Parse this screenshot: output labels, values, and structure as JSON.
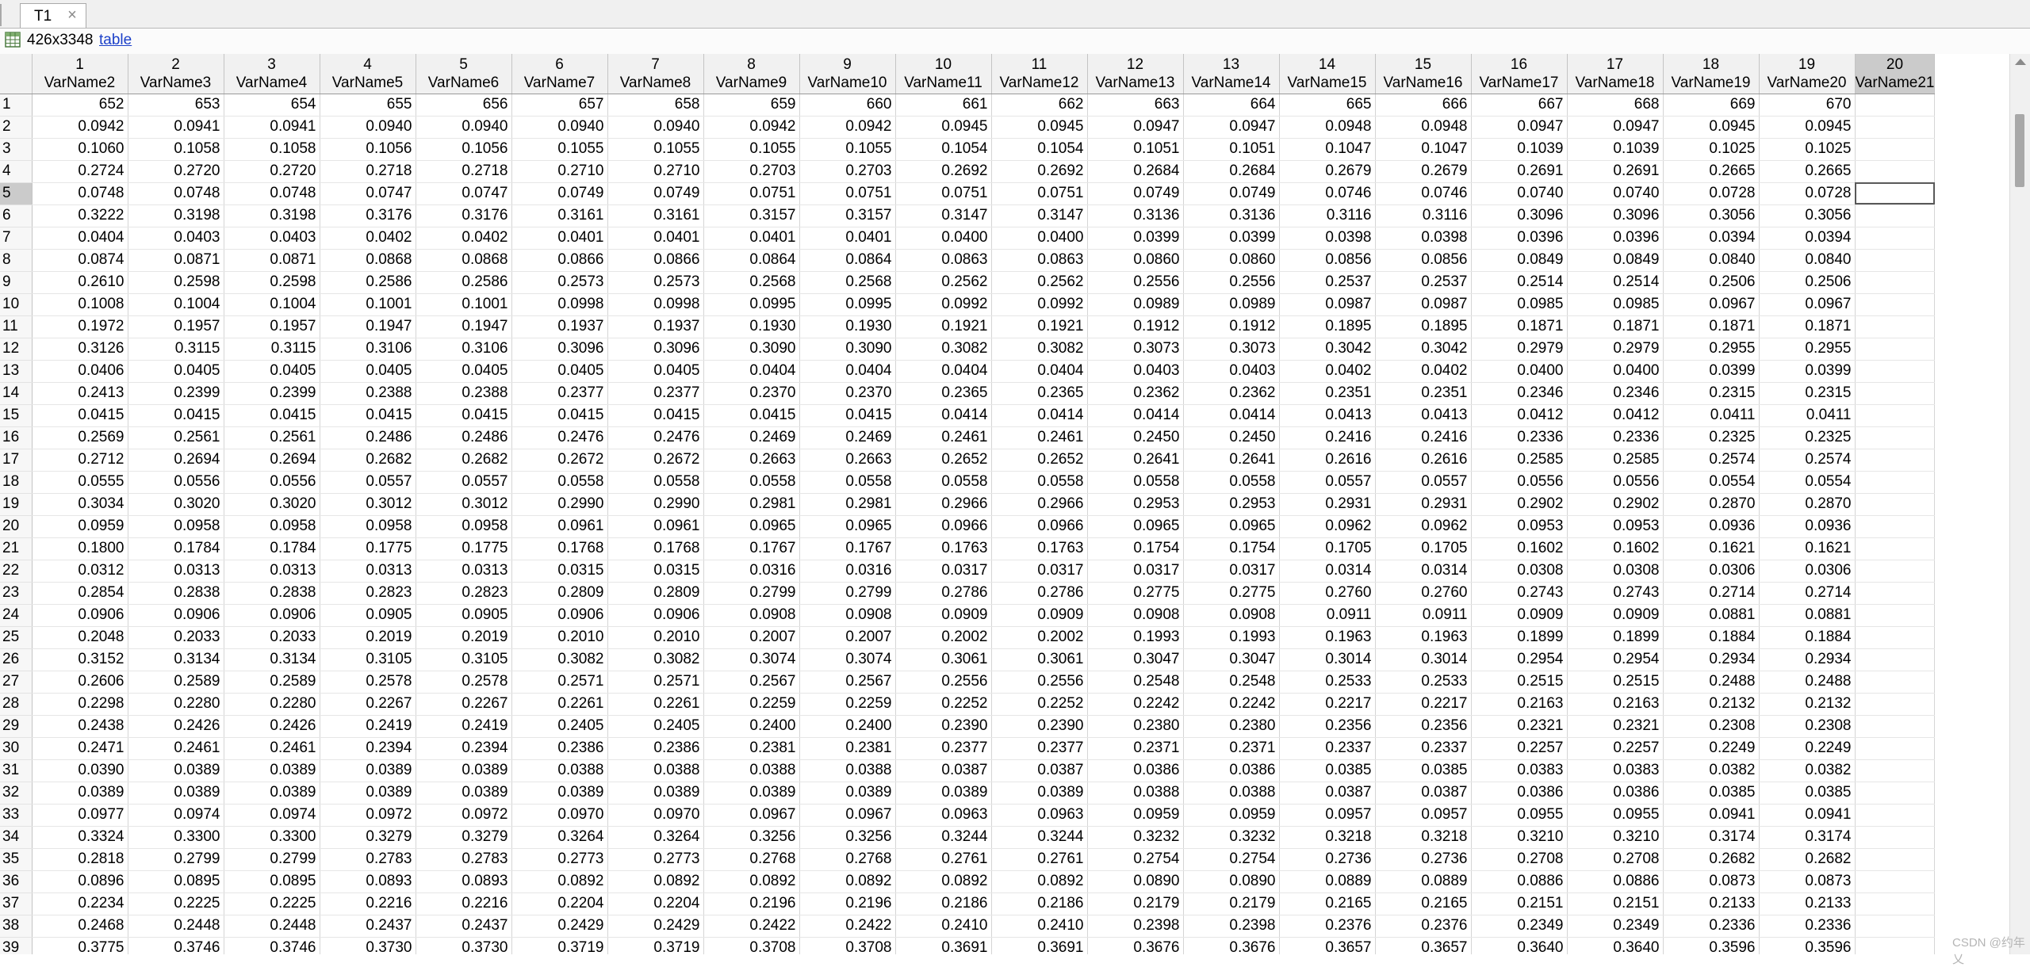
{
  "tab": {
    "title": "T1",
    "close_glyph": "×"
  },
  "info": {
    "size": "426x3348",
    "type_link": "table",
    "icon": "table-icon"
  },
  "columns": [
    {
      "index": "1",
      "name": "VarName2"
    },
    {
      "index": "2",
      "name": "VarName3"
    },
    {
      "index": "3",
      "name": "VarName4"
    },
    {
      "index": "4",
      "name": "VarName5"
    },
    {
      "index": "5",
      "name": "VarName6"
    },
    {
      "index": "6",
      "name": "VarName7"
    },
    {
      "index": "7",
      "name": "VarName8"
    },
    {
      "index": "8",
      "name": "VarName9"
    },
    {
      "index": "9",
      "name": "VarName10"
    },
    {
      "index": "10",
      "name": "VarName11"
    },
    {
      "index": "11",
      "name": "VarName12"
    },
    {
      "index": "12",
      "name": "VarName13"
    },
    {
      "index": "13",
      "name": "VarName14"
    },
    {
      "index": "14",
      "name": "VarName15"
    },
    {
      "index": "15",
      "name": "VarName16"
    },
    {
      "index": "16",
      "name": "VarName17"
    },
    {
      "index": "17",
      "name": "VarName18"
    },
    {
      "index": "18",
      "name": "VarName19"
    },
    {
      "index": "19",
      "name": "VarName20"
    },
    {
      "index": "20",
      "name": "VarName21"
    }
  ],
  "selected_row": 5,
  "selected_col": 20,
  "rows": [
    [
      "652",
      "653",
      "654",
      "655",
      "656",
      "657",
      "658",
      "659",
      "660",
      "661",
      "662",
      "663",
      "664",
      "665",
      "666",
      "667",
      "668",
      "669",
      "670",
      ""
    ],
    [
      "0.0942",
      "0.0941",
      "0.0941",
      "0.0940",
      "0.0940",
      "0.0940",
      "0.0940",
      "0.0942",
      "0.0942",
      "0.0945",
      "0.0945",
      "0.0947",
      "0.0947",
      "0.0948",
      "0.0948",
      "0.0947",
      "0.0947",
      "0.0945",
      "0.0945",
      ""
    ],
    [
      "0.1060",
      "0.1058",
      "0.1058",
      "0.1056",
      "0.1056",
      "0.1055",
      "0.1055",
      "0.1055",
      "0.1055",
      "0.1054",
      "0.1054",
      "0.1051",
      "0.1051",
      "0.1047",
      "0.1047",
      "0.1039",
      "0.1039",
      "0.1025",
      "0.1025",
      ""
    ],
    [
      "0.2724",
      "0.2720",
      "0.2720",
      "0.2718",
      "0.2718",
      "0.2710",
      "0.2710",
      "0.2703",
      "0.2703",
      "0.2692",
      "0.2692",
      "0.2684",
      "0.2684",
      "0.2679",
      "0.2679",
      "0.2691",
      "0.2691",
      "0.2665",
      "0.2665",
      ""
    ],
    [
      "0.0748",
      "0.0748",
      "0.0748",
      "0.0747",
      "0.0747",
      "0.0749",
      "0.0749",
      "0.0751",
      "0.0751",
      "0.0751",
      "0.0751",
      "0.0749",
      "0.0749",
      "0.0746",
      "0.0746",
      "0.0740",
      "0.0740",
      "0.0728",
      "0.0728",
      ""
    ],
    [
      "0.3222",
      "0.3198",
      "0.3198",
      "0.3176",
      "0.3176",
      "0.3161",
      "0.3161",
      "0.3157",
      "0.3157",
      "0.3147",
      "0.3147",
      "0.3136",
      "0.3136",
      "0.3116",
      "0.3116",
      "0.3096",
      "0.3096",
      "0.3056",
      "0.3056",
      ""
    ],
    [
      "0.0404",
      "0.0403",
      "0.0403",
      "0.0402",
      "0.0402",
      "0.0401",
      "0.0401",
      "0.0401",
      "0.0401",
      "0.0400",
      "0.0400",
      "0.0399",
      "0.0399",
      "0.0398",
      "0.0398",
      "0.0396",
      "0.0396",
      "0.0394",
      "0.0394",
      ""
    ],
    [
      "0.0874",
      "0.0871",
      "0.0871",
      "0.0868",
      "0.0868",
      "0.0866",
      "0.0866",
      "0.0864",
      "0.0864",
      "0.0863",
      "0.0863",
      "0.0860",
      "0.0860",
      "0.0856",
      "0.0856",
      "0.0849",
      "0.0849",
      "0.0840",
      "0.0840",
      ""
    ],
    [
      "0.2610",
      "0.2598",
      "0.2598",
      "0.2586",
      "0.2586",
      "0.2573",
      "0.2573",
      "0.2568",
      "0.2568",
      "0.2562",
      "0.2562",
      "0.2556",
      "0.2556",
      "0.2537",
      "0.2537",
      "0.2514",
      "0.2514",
      "0.2506",
      "0.2506",
      ""
    ],
    [
      "0.1008",
      "0.1004",
      "0.1004",
      "0.1001",
      "0.1001",
      "0.0998",
      "0.0998",
      "0.0995",
      "0.0995",
      "0.0992",
      "0.0992",
      "0.0989",
      "0.0989",
      "0.0987",
      "0.0987",
      "0.0985",
      "0.0985",
      "0.0967",
      "0.0967",
      ""
    ],
    [
      "0.1972",
      "0.1957",
      "0.1957",
      "0.1947",
      "0.1947",
      "0.1937",
      "0.1937",
      "0.1930",
      "0.1930",
      "0.1921",
      "0.1921",
      "0.1912",
      "0.1912",
      "0.1895",
      "0.1895",
      "0.1871",
      "0.1871",
      "0.1871",
      "0.1871",
      ""
    ],
    [
      "0.3126",
      "0.3115",
      "0.3115",
      "0.3106",
      "0.3106",
      "0.3096",
      "0.3096",
      "0.3090",
      "0.3090",
      "0.3082",
      "0.3082",
      "0.3073",
      "0.3073",
      "0.3042",
      "0.3042",
      "0.2979",
      "0.2979",
      "0.2955",
      "0.2955",
      ""
    ],
    [
      "0.0406",
      "0.0405",
      "0.0405",
      "0.0405",
      "0.0405",
      "0.0405",
      "0.0405",
      "0.0404",
      "0.0404",
      "0.0404",
      "0.0404",
      "0.0403",
      "0.0403",
      "0.0402",
      "0.0402",
      "0.0400",
      "0.0400",
      "0.0399",
      "0.0399",
      ""
    ],
    [
      "0.2413",
      "0.2399",
      "0.2399",
      "0.2388",
      "0.2388",
      "0.2377",
      "0.2377",
      "0.2370",
      "0.2370",
      "0.2365",
      "0.2365",
      "0.2362",
      "0.2362",
      "0.2351",
      "0.2351",
      "0.2346",
      "0.2346",
      "0.2315",
      "0.2315",
      ""
    ],
    [
      "0.0415",
      "0.0415",
      "0.0415",
      "0.0415",
      "0.0415",
      "0.0415",
      "0.0415",
      "0.0415",
      "0.0415",
      "0.0414",
      "0.0414",
      "0.0414",
      "0.0414",
      "0.0413",
      "0.0413",
      "0.0412",
      "0.0412",
      "0.0411",
      "0.0411",
      ""
    ],
    [
      "0.2569",
      "0.2561",
      "0.2561",
      "0.2486",
      "0.2486",
      "0.2476",
      "0.2476",
      "0.2469",
      "0.2469",
      "0.2461",
      "0.2461",
      "0.2450",
      "0.2450",
      "0.2416",
      "0.2416",
      "0.2336",
      "0.2336",
      "0.2325",
      "0.2325",
      ""
    ],
    [
      "0.2712",
      "0.2694",
      "0.2694",
      "0.2682",
      "0.2682",
      "0.2672",
      "0.2672",
      "0.2663",
      "0.2663",
      "0.2652",
      "0.2652",
      "0.2641",
      "0.2641",
      "0.2616",
      "0.2616",
      "0.2585",
      "0.2585",
      "0.2574",
      "0.2574",
      ""
    ],
    [
      "0.0555",
      "0.0556",
      "0.0556",
      "0.0557",
      "0.0557",
      "0.0558",
      "0.0558",
      "0.0558",
      "0.0558",
      "0.0558",
      "0.0558",
      "0.0558",
      "0.0558",
      "0.0557",
      "0.0557",
      "0.0556",
      "0.0556",
      "0.0554",
      "0.0554",
      ""
    ],
    [
      "0.3034",
      "0.3020",
      "0.3020",
      "0.3012",
      "0.3012",
      "0.2990",
      "0.2990",
      "0.2981",
      "0.2981",
      "0.2966",
      "0.2966",
      "0.2953",
      "0.2953",
      "0.2931",
      "0.2931",
      "0.2902",
      "0.2902",
      "0.2870",
      "0.2870",
      ""
    ],
    [
      "0.0959",
      "0.0958",
      "0.0958",
      "0.0958",
      "0.0958",
      "0.0961",
      "0.0961",
      "0.0965",
      "0.0965",
      "0.0966",
      "0.0966",
      "0.0965",
      "0.0965",
      "0.0962",
      "0.0962",
      "0.0953",
      "0.0953",
      "0.0936",
      "0.0936",
      ""
    ],
    [
      "0.1800",
      "0.1784",
      "0.1784",
      "0.1775",
      "0.1775",
      "0.1768",
      "0.1768",
      "0.1767",
      "0.1767",
      "0.1763",
      "0.1763",
      "0.1754",
      "0.1754",
      "0.1705",
      "0.1705",
      "0.1602",
      "0.1602",
      "0.1621",
      "0.1621",
      ""
    ],
    [
      "0.0312",
      "0.0313",
      "0.0313",
      "0.0313",
      "0.0313",
      "0.0315",
      "0.0315",
      "0.0316",
      "0.0316",
      "0.0317",
      "0.0317",
      "0.0317",
      "0.0317",
      "0.0314",
      "0.0314",
      "0.0308",
      "0.0308",
      "0.0306",
      "0.0306",
      ""
    ],
    [
      "0.2854",
      "0.2838",
      "0.2838",
      "0.2823",
      "0.2823",
      "0.2809",
      "0.2809",
      "0.2799",
      "0.2799",
      "0.2786",
      "0.2786",
      "0.2775",
      "0.2775",
      "0.2760",
      "0.2760",
      "0.2743",
      "0.2743",
      "0.2714",
      "0.2714",
      ""
    ],
    [
      "0.0906",
      "0.0906",
      "0.0906",
      "0.0905",
      "0.0905",
      "0.0906",
      "0.0906",
      "0.0908",
      "0.0908",
      "0.0909",
      "0.0909",
      "0.0908",
      "0.0908",
      "0.0911",
      "0.0911",
      "0.0909",
      "0.0909",
      "0.0881",
      "0.0881",
      ""
    ],
    [
      "0.2048",
      "0.2033",
      "0.2033",
      "0.2019",
      "0.2019",
      "0.2010",
      "0.2010",
      "0.2007",
      "0.2007",
      "0.2002",
      "0.2002",
      "0.1993",
      "0.1993",
      "0.1963",
      "0.1963",
      "0.1899",
      "0.1899",
      "0.1884",
      "0.1884",
      ""
    ],
    [
      "0.3152",
      "0.3134",
      "0.3134",
      "0.3105",
      "0.3105",
      "0.3082",
      "0.3082",
      "0.3074",
      "0.3074",
      "0.3061",
      "0.3061",
      "0.3047",
      "0.3047",
      "0.3014",
      "0.3014",
      "0.2954",
      "0.2954",
      "0.2934",
      "0.2934",
      ""
    ],
    [
      "0.2606",
      "0.2589",
      "0.2589",
      "0.2578",
      "0.2578",
      "0.2571",
      "0.2571",
      "0.2567",
      "0.2567",
      "0.2556",
      "0.2556",
      "0.2548",
      "0.2548",
      "0.2533",
      "0.2533",
      "0.2515",
      "0.2515",
      "0.2488",
      "0.2488",
      ""
    ],
    [
      "0.2298",
      "0.2280",
      "0.2280",
      "0.2267",
      "0.2267",
      "0.2261",
      "0.2261",
      "0.2259",
      "0.2259",
      "0.2252",
      "0.2252",
      "0.2242",
      "0.2242",
      "0.2217",
      "0.2217",
      "0.2163",
      "0.2163",
      "0.2132",
      "0.2132",
      ""
    ],
    [
      "0.2438",
      "0.2426",
      "0.2426",
      "0.2419",
      "0.2419",
      "0.2405",
      "0.2405",
      "0.2400",
      "0.2400",
      "0.2390",
      "0.2390",
      "0.2380",
      "0.2380",
      "0.2356",
      "0.2356",
      "0.2321",
      "0.2321",
      "0.2308",
      "0.2308",
      ""
    ],
    [
      "0.2471",
      "0.2461",
      "0.2461",
      "0.2394",
      "0.2394",
      "0.2386",
      "0.2386",
      "0.2381",
      "0.2381",
      "0.2377",
      "0.2377",
      "0.2371",
      "0.2371",
      "0.2337",
      "0.2337",
      "0.2257",
      "0.2257",
      "0.2249",
      "0.2249",
      ""
    ],
    [
      "0.0390",
      "0.0389",
      "0.0389",
      "0.0389",
      "0.0389",
      "0.0388",
      "0.0388",
      "0.0388",
      "0.0388",
      "0.0387",
      "0.0387",
      "0.0386",
      "0.0386",
      "0.0385",
      "0.0385",
      "0.0383",
      "0.0383",
      "0.0382",
      "0.0382",
      ""
    ],
    [
      "0.0389",
      "0.0389",
      "0.0389",
      "0.0389",
      "0.0389",
      "0.0389",
      "0.0389",
      "0.0389",
      "0.0389",
      "0.0389",
      "0.0389",
      "0.0388",
      "0.0388",
      "0.0387",
      "0.0387",
      "0.0386",
      "0.0386",
      "0.0385",
      "0.0385",
      ""
    ],
    [
      "0.0977",
      "0.0974",
      "0.0974",
      "0.0972",
      "0.0972",
      "0.0970",
      "0.0970",
      "0.0967",
      "0.0967",
      "0.0963",
      "0.0963",
      "0.0959",
      "0.0959",
      "0.0957",
      "0.0957",
      "0.0955",
      "0.0955",
      "0.0941",
      "0.0941",
      ""
    ],
    [
      "0.3324",
      "0.3300",
      "0.3300",
      "0.3279",
      "0.3279",
      "0.3264",
      "0.3264",
      "0.3256",
      "0.3256",
      "0.3244",
      "0.3244",
      "0.3232",
      "0.3232",
      "0.3218",
      "0.3218",
      "0.3210",
      "0.3210",
      "0.3174",
      "0.3174",
      ""
    ],
    [
      "0.2818",
      "0.2799",
      "0.2799",
      "0.2783",
      "0.2783",
      "0.2773",
      "0.2773",
      "0.2768",
      "0.2768",
      "0.2761",
      "0.2761",
      "0.2754",
      "0.2754",
      "0.2736",
      "0.2736",
      "0.2708",
      "0.2708",
      "0.2682",
      "0.2682",
      ""
    ],
    [
      "0.0896",
      "0.0895",
      "0.0895",
      "0.0893",
      "0.0893",
      "0.0892",
      "0.0892",
      "0.0892",
      "0.0892",
      "0.0892",
      "0.0892",
      "0.0890",
      "0.0890",
      "0.0889",
      "0.0889",
      "0.0886",
      "0.0886",
      "0.0873",
      "0.0873",
      ""
    ],
    [
      "0.2234",
      "0.2225",
      "0.2225",
      "0.2216",
      "0.2216",
      "0.2204",
      "0.2204",
      "0.2196",
      "0.2196",
      "0.2186",
      "0.2186",
      "0.2179",
      "0.2179",
      "0.2165",
      "0.2165",
      "0.2151",
      "0.2151",
      "0.2133",
      "0.2133",
      ""
    ],
    [
      "0.2468",
      "0.2448",
      "0.2448",
      "0.2437",
      "0.2437",
      "0.2429",
      "0.2429",
      "0.2422",
      "0.2422",
      "0.2410",
      "0.2410",
      "0.2398",
      "0.2398",
      "0.2376",
      "0.2376",
      "0.2349",
      "0.2349",
      "0.2336",
      "0.2336",
      ""
    ],
    [
      "0.3775",
      "0.3746",
      "0.3746",
      "0.3730",
      "0.3730",
      "0.3719",
      "0.3719",
      "0.3708",
      "0.3708",
      "0.3691",
      "0.3691",
      "0.3676",
      "0.3676",
      "0.3657",
      "0.3657",
      "0.3640",
      "0.3640",
      "0.3596",
      "0.3596",
      ""
    ]
  ],
  "watermark": "CSDN @约年乂"
}
